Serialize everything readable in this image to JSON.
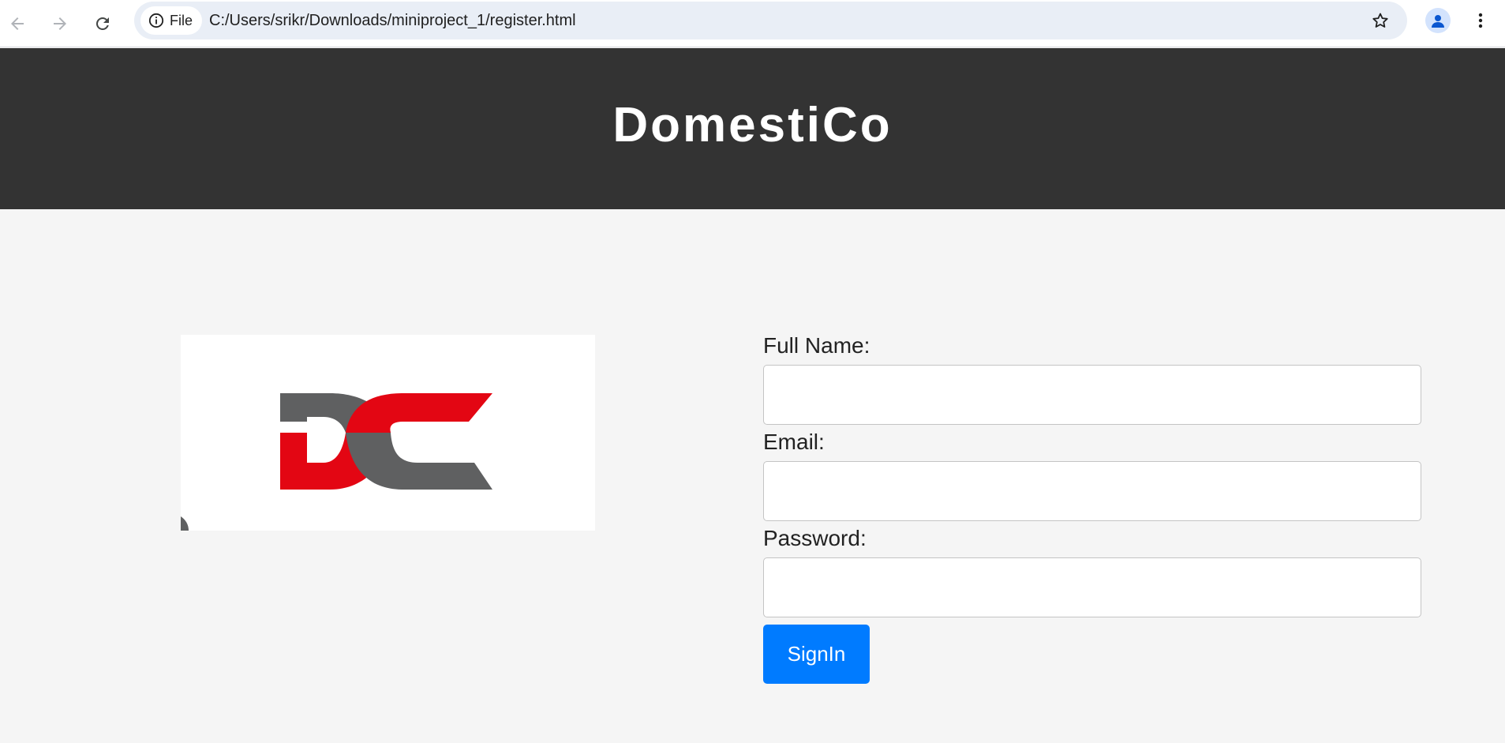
{
  "browser": {
    "back_icon": "arrow-left-icon",
    "forward_icon": "arrow-right-icon",
    "reload_icon": "reload-icon",
    "site_info_label": "File",
    "site_info_icon": "info-circle-icon",
    "url": "C:/Users/srikr/Downloads/miniproject_1/register.html",
    "bookmark_icon": "star-icon",
    "profile_icon": "person-icon",
    "menu_icon": "more-vertical-icon"
  },
  "header": {
    "title": "DomestiCo"
  },
  "logo": {
    "icon": "dc-logo",
    "text": "DC",
    "colors": {
      "red": "#e30613",
      "gray": "#5f6061"
    }
  },
  "form": {
    "full_name_label": "Full Name:",
    "full_name_value": "",
    "email_label": "Email:",
    "email_value": "",
    "password_label": "Password:",
    "password_value": "",
    "submit_label": "SignIn"
  },
  "colors": {
    "header_bg": "#333333",
    "page_bg": "#f5f5f5",
    "button_bg": "#007bff",
    "button_text": "#ffffff"
  }
}
